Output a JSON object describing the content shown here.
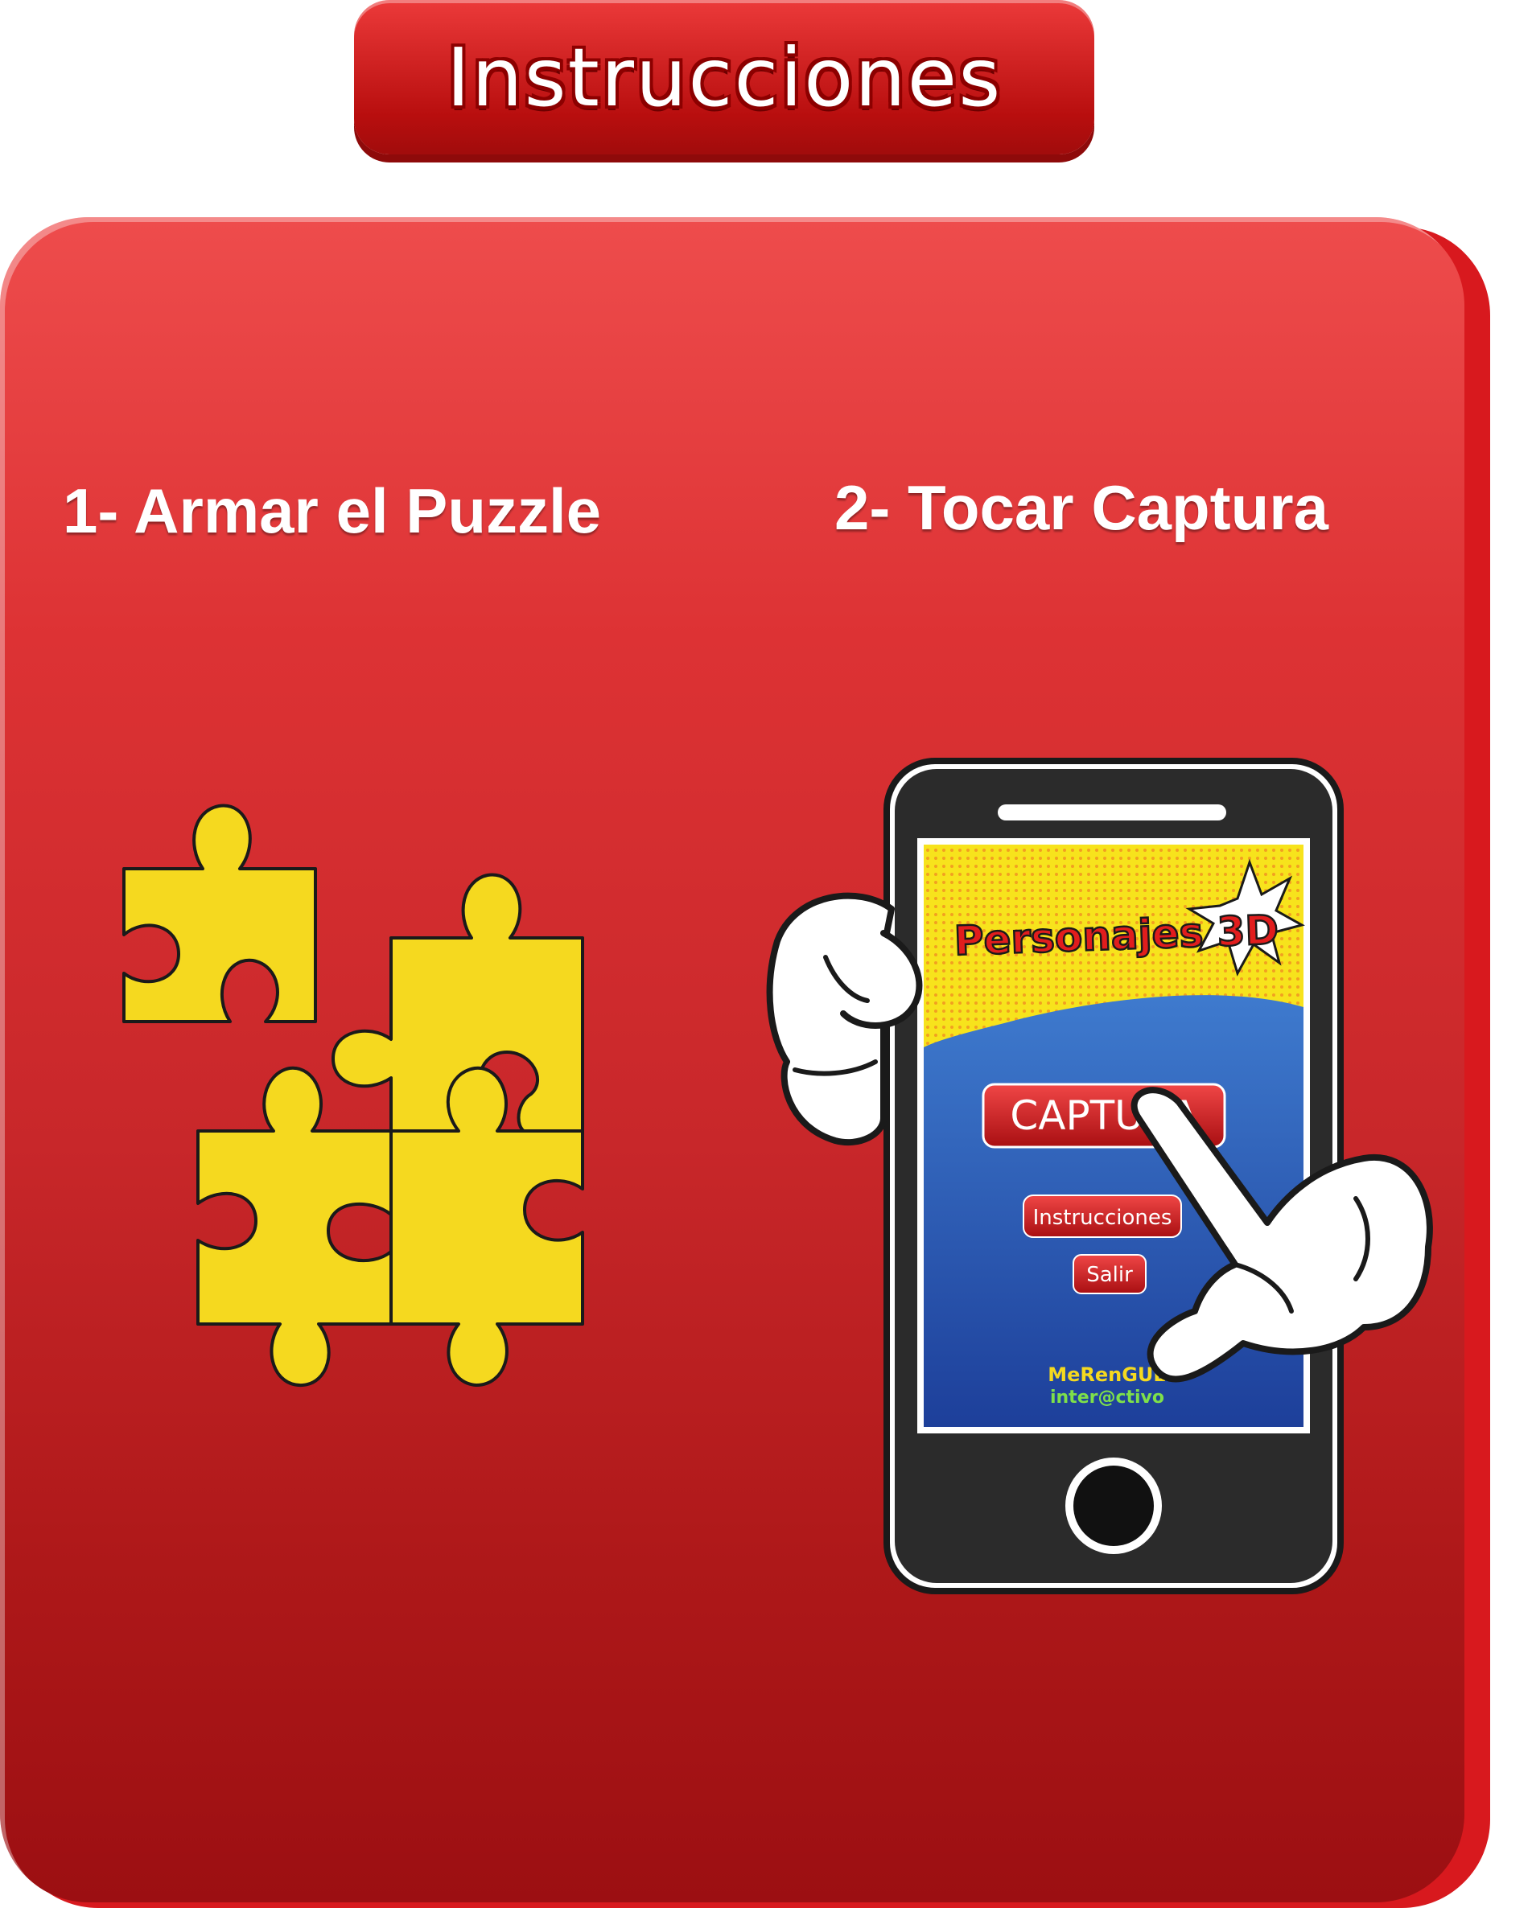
{
  "header": {
    "title": "Instrucciones"
  },
  "steps": [
    {
      "label": "1- Armar el Puzzle"
    },
    {
      "label": "2- Tocar Captura"
    }
  ],
  "phone_app": {
    "app_title": "Personajes 3D",
    "capture_button": "CAPTURA",
    "instructions_button": "Instrucciones",
    "exit_button": "Salir",
    "brand_line1": "MeRenGUE",
    "brand_line2": "inter@ctivo"
  },
  "colors": {
    "panel_red": "#dd3234",
    "puzzle_yellow": "#f5d91f",
    "phone_screen_blue": "#2f5ab8",
    "banner_yellow": "#f7e31c"
  },
  "icons": [
    "puzzle-pieces-illustration",
    "smartphone-illustration",
    "hand-holding-icon",
    "pointing-hand-icon"
  ]
}
